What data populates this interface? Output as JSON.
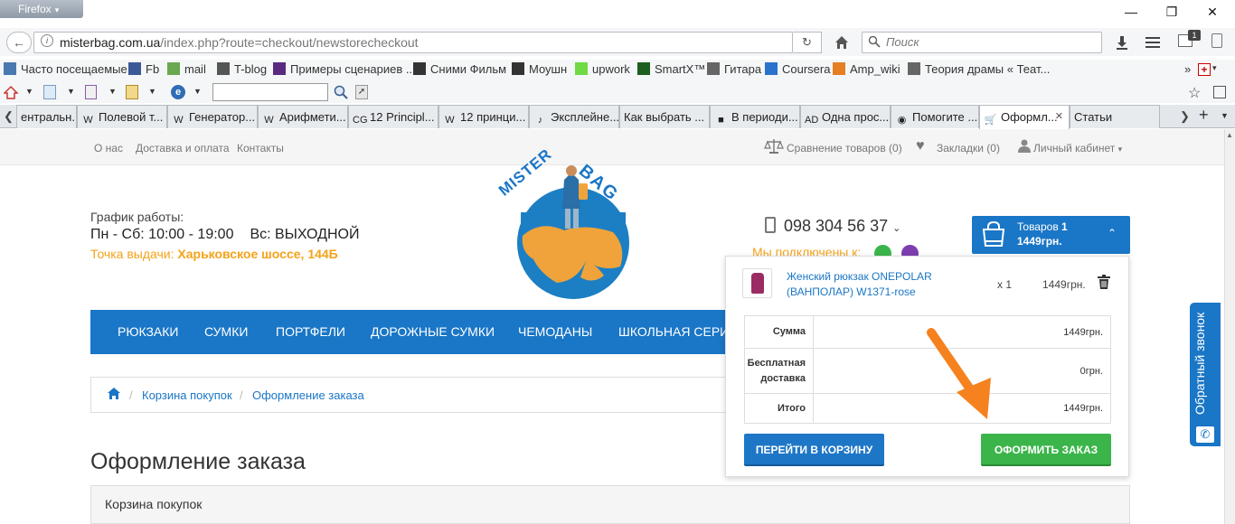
{
  "browser": {
    "app_menu": "Firefox",
    "url_host": "misterbag.com.ua",
    "url_path": "/index.php?route=checkout/newstorecheckout",
    "search_placeholder": "Поиск",
    "download_badge": "1",
    "bookmarks": [
      {
        "label": "Часто посещаемые",
        "icon": "gear-icon",
        "color": "#4a78b0"
      },
      {
        "label": "Fb",
        "icon": "facebook-icon",
        "color": "#3b5998"
      },
      {
        "label": "mail",
        "icon": "mail-icon",
        "color": "#69a84f"
      },
      {
        "label": "T-blog",
        "icon": "gear-icon",
        "color": "#555555"
      },
      {
        "label": "Примеры сценариев ...",
        "icon": "folder-icon",
        "color": "#5a2a82"
      },
      {
        "label": "Сними Фильм",
        "icon": "clapper-icon",
        "color": "#333333"
      },
      {
        "label": "Моушн",
        "icon": "d-icon",
        "color": "#333333"
      },
      {
        "label": "upwork",
        "icon": "upwork-icon",
        "color": "#6fda44"
      },
      {
        "label": "SmartX™",
        "icon": "smartx-icon",
        "color": "#1b5e20"
      },
      {
        "label": "Гитара",
        "icon": "globe-icon",
        "color": "#666666"
      },
      {
        "label": "Coursera",
        "icon": "coursera-icon",
        "color": "#2a73cc"
      },
      {
        "label": "Amp_wiki",
        "icon": "amp-icon",
        "color": "#e67e22"
      },
      {
        "label": "Теория драмы « Теат...",
        "icon": "globe-icon",
        "color": "#666666"
      }
    ],
    "tabs": [
      {
        "label": "ентральн...",
        "icon": ""
      },
      {
        "label": "Полевой т...",
        "icon": "W"
      },
      {
        "label": "Генератор...",
        "icon": "W"
      },
      {
        "label": "Арифмети...",
        "icon": "W"
      },
      {
        "label": "12 Principl...",
        "icon": "CG"
      },
      {
        "label": "12 принци...",
        "icon": "W"
      },
      {
        "label": "Эксплейне...",
        "icon": "♪"
      },
      {
        "label": "Как выбрать ...",
        "icon": ""
      },
      {
        "label": "В периоди...",
        "icon": "■"
      },
      {
        "label": "Одна прос...",
        "icon": "AD"
      },
      {
        "label": "Помогите ...",
        "icon": "◉"
      },
      {
        "label": "Оформл...",
        "icon": "🛒",
        "active": true
      },
      {
        "label": "Статьи",
        "icon": ""
      }
    ]
  },
  "site": {
    "top_links": [
      "О нас",
      "Доставка и оплата",
      "Контакты"
    ],
    "compare": "Сравнение товаров (0)",
    "bookmarks": "Закладки (0)",
    "account": "Личный кабинет",
    "logo_text_1": "MISTER",
    "logo_text_2": "BAG",
    "hours_label": "График работы:",
    "hours_weekdays": "Пн - Сб: 10:00 - 19:00",
    "hours_sunday": "Вс: ВЫХОДНОЙ",
    "pickup_label": "Точка выдачи:",
    "pickup_address": "Харьковское шоссе, 144Б",
    "phone": "098 304 56 37",
    "connected": "Мы подключены к:",
    "cart_items_label": "Товаров",
    "cart_items_count": "1",
    "cart_total": "1449грн.",
    "menu": [
      "РЮКЗАКИ",
      "СУМКИ",
      "ПОРТФЕЛИ",
      "ДОРОЖНЫЕ СУМКИ",
      "ЧЕМОДАНЫ",
      "ШКОЛЬНАЯ СЕРИЯ"
    ],
    "breadcrumb": [
      "Корзина покупок",
      "Оформление заказа"
    ],
    "page_title": "Оформление заказа",
    "cart_panel_title": "Корзина покупок",
    "callback": "Обратный звонок"
  },
  "dropdown": {
    "product_name": "Женский рюкзак ONEPOLAR (ВАНПОЛАР) W1371-rose",
    "qty": "x 1",
    "price": "1449грн.",
    "rows": [
      {
        "label": "Сумма",
        "value": "1449грн."
      },
      {
        "label": "Бесплатная доставка",
        "value": "0грн."
      },
      {
        "label": "Итого",
        "value": "1449грн."
      }
    ],
    "btn_cart": "ПЕРЕЙТИ В КОРЗИНУ",
    "btn_checkout": "ОФОРМИТЬ ЗАКАЗ"
  },
  "colors": {
    "brand_blue": "#1a76c6",
    "accent_orange": "#f4a31a",
    "checkout_green": "#3bb54a",
    "arrow_orange": "#f5821f"
  }
}
